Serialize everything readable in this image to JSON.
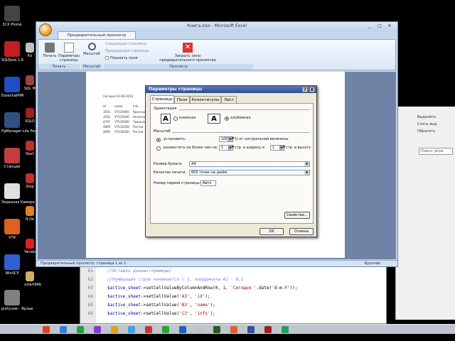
{
  "desktop_icons": [
    {
      "label": "3CX Phone",
      "color": "#444444"
    },
    {
      "label": "SQLTools 1.6",
      "color": "#c02020"
    },
    {
      "label": "EssentialPIM",
      "color": "#2050c0"
    },
    {
      "label": "PgManager Lite Post...",
      "color": "#305080"
    },
    {
      "label": "Станции",
      "color": "#c04040"
    },
    {
      "label": "Экранная Камера",
      "color": "#e0e0e0"
    },
    {
      "label": "VTR",
      "color": "#e06020"
    },
    {
      "label": "WinSCP",
      "color": "#3060d0"
    },
    {
      "label": "putty.exe - Ярлык",
      "color": "#808080"
    }
  ],
  "desktop_icons_col2": [
    {
      "label": "Ко",
      "color": "#c0c0c0"
    },
    {
      "label": "SQL Mana",
      "color": "#a04040"
    },
    {
      "label": "SQLO",
      "color": "#a02020"
    },
    {
      "label": "Start",
      "color": "#c03030"
    },
    {
      "label": "Stop",
      "color": "#c03030"
    },
    {
      "label": "R De",
      "color": "#e08020"
    },
    {
      "label": "Yandex",
      "color": "#e02020"
    },
    {
      "label": "xstart94b",
      "color": "#d0b060"
    }
  ],
  "excel": {
    "window_title": "Книга.xlsx - Microsoft Excel",
    "ribbon_tab": "Предварительный просмотр",
    "buttons": {
      "print": "Печать",
      "page_setup": "Параметры страницы",
      "zoom": "Масштаб",
      "next_page": "Следующая страница",
      "prev_page": "Предыдущая страница",
      "show_margins": "Показать поля",
      "close_preview": "Закрыть окно предварительного просмотра"
    },
    "groups": {
      "print": "Печать",
      "zoom": "Масштаб",
      "preview": "Просмотр"
    },
    "paper": {
      "date_line": "Сегодня 03-06-2014",
      "headers": [
        "id",
        "name",
        "info"
      ],
      "rows": [
        [
          "3501",
          "VTU24000",
          "Краснодар"
        ],
        [
          "3501",
          "VTU25040",
          "Ногинск"
        ],
        [
          "4797",
          "VTU30000",
          "Тюменская"
        ],
        [
          "4890",
          "VTU30100",
          "Ростов"
        ],
        [
          "4890",
          "VTU30400",
          "Ростов"
        ]
      ]
    },
    "status_text": "Предварительный просмотр: страница 1 из 1",
    "status_zoom": "Крупнее"
  },
  "dialog": {
    "title": "Параметры страницы",
    "help": "?",
    "close": "X",
    "tabs": [
      "Страница",
      "Поля",
      "Колонтитулы",
      "Лист"
    ],
    "orientation_label": "Ориентация",
    "portrait": "книжная",
    "landscape": "альбомная",
    "scale_label": "Масштаб",
    "set_label": "установить:",
    "set_value": "100",
    "set_suffix": "% от натуральной величины",
    "fit_label": "разместить не более чем на:",
    "fit_wide": "1",
    "fit_wide_suffix": "стр. в ширину и",
    "fit_tall": "1",
    "fit_tall_suffix": "стр. в высоту",
    "paper_size_label": "Размер бумаги:",
    "paper_size_value": "A4",
    "print_quality_label": "Качество печати:",
    "print_quality_value": "600 точек на дюйм",
    "first_page_label": "Номер первой страницы:",
    "first_page_value": "Авто",
    "properties_button": "Свойства...",
    "ok_button": "OK",
    "cancel_button": "Отмена"
  },
  "editor": {
    "lines": [
      {
        "n": "61",
        "parts": [
          {
            "t": "//Вставка данных(примеры)",
            "c": "cmt"
          }
        ]
      },
      {
        "n": "62",
        "parts": [
          {
            "t": "//Нумерация строк начинается с 1, координаты A1 - 0,1",
            "c": "cmt"
          }
        ]
      },
      {
        "n": "63",
        "parts": [
          {
            "t": "$active_sheet",
            "c": "var"
          },
          {
            "t": "->setCellValueByColumnAndRow(0, 1, ",
            "c": ""
          },
          {
            "t": "'Сегодня '",
            "c": "str"
          },
          {
            "t": ".date('d-m-Y'));",
            "c": ""
          }
        ]
      },
      {
        "n": "64",
        "parts": [
          {
            "t": "$active_sheet",
            "c": "var"
          },
          {
            "t": "->setCellValue(",
            "c": ""
          },
          {
            "t": "'A3'",
            "c": "str"
          },
          {
            "t": ", ",
            "c": ""
          },
          {
            "t": "'id'",
            "c": "str"
          },
          {
            "t": ");",
            "c": ""
          }
        ]
      },
      {
        "n": "65",
        "parts": [
          {
            "t": "$active_sheet",
            "c": "var"
          },
          {
            "t": "->setCellValue(",
            "c": ""
          },
          {
            "t": "'B3'",
            "c": "str"
          },
          {
            "t": ", ",
            "c": ""
          },
          {
            "t": "'name'",
            "c": "str"
          },
          {
            "t": ");",
            "c": ""
          }
        ]
      },
      {
        "n": "66",
        "parts": [
          {
            "t": "$active_sheet",
            "c": "var"
          },
          {
            "t": "->setCellValue(",
            "c": ""
          },
          {
            "t": "'C3'",
            "c": "str"
          },
          {
            "t": ", ",
            "c": ""
          },
          {
            "t": "'info'",
            "c": "str"
          },
          {
            "t": ");",
            "c": ""
          }
        ]
      }
    ]
  },
  "right_panel": {
    "items": [
      "Выделить",
      "Снять выд",
      "Обратить"
    ],
    "search_placeholder": "Поиск: phpe"
  },
  "taskbar_icons": [
    {
      "color": "#e04020"
    },
    {
      "color": "#3080e0"
    },
    {
      "color": "#20a040"
    },
    {
      "color": "#8040c0"
    },
    {
      "color": "#e0a020"
    },
    {
      "color": "#40a0e0"
    },
    {
      "color": "#d03030"
    },
    {
      "color": "#30a030"
    },
    {
      "color": "#2060c0"
    },
    {
      "color": "#c0c0c0"
    },
    {
      "color": "#206020"
    },
    {
      "color": "#e06020"
    },
    {
      "color": "#3050a0"
    },
    {
      "color": "#a02020"
    },
    {
      "color": "#20a060"
    }
  ]
}
